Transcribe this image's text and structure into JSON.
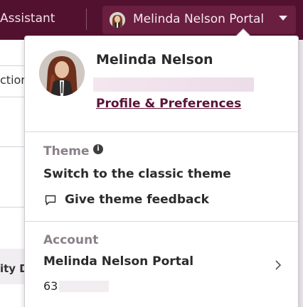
{
  "topbar": {
    "assistant_label": "Assistant",
    "portal_label": "Melinda Nelson Portal",
    "bg_color": "#52122f"
  },
  "background": {
    "fragment_top": "ction",
    "fragment_bottom": "ity D"
  },
  "profile": {
    "name": "Melinda Nelson",
    "link_label": "Profile & Preferences"
  },
  "theme": {
    "title": "Theme",
    "info_icon": "info-icon",
    "switch_label": "Switch to the classic theme",
    "feedback_label": "Give theme feedback"
  },
  "account": {
    "title": "Account",
    "portal_name": "Melinda Nelson Portal",
    "portal_id_visible": "63"
  },
  "colors": {
    "accent": "#5c1237",
    "header": "#52122f",
    "muted": "#8a8089"
  }
}
